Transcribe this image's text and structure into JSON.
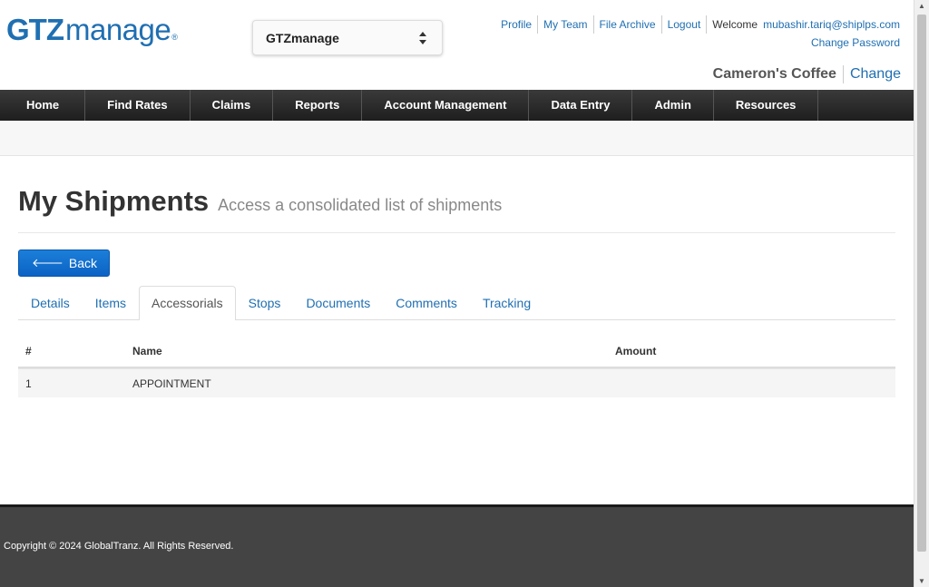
{
  "header": {
    "logo_bold": "GTZ",
    "logo_light": "manage",
    "logo_reg": "®",
    "app_select_value": "GTZmanage",
    "links": [
      "Profile",
      "My Team",
      "File Archive",
      "Logout"
    ],
    "welcome": "Welcome",
    "email": "mubashir.tariq@shiplps.com",
    "change_password": "Change Password",
    "company": "Cameron's Coffee",
    "company_change": "Change"
  },
  "nav": [
    "Home",
    "Find Rates",
    "Claims",
    "Reports",
    "Account Management",
    "Data Entry",
    "Admin",
    "Resources"
  ],
  "page": {
    "title": "My Shipments",
    "subtitle": "Access a consolidated list of shipments",
    "back_label": "Back"
  },
  "tabs": [
    {
      "label": "Details",
      "active": false
    },
    {
      "label": "Items",
      "active": false
    },
    {
      "label": "Accessorials",
      "active": true
    },
    {
      "label": "Stops",
      "active": false
    },
    {
      "label": "Documents",
      "active": false
    },
    {
      "label": "Comments",
      "active": false
    },
    {
      "label": "Tracking",
      "active": false
    }
  ],
  "table": {
    "headers": [
      "#",
      "Name",
      "Amount"
    ],
    "rows": [
      [
        "1",
        "APPOINTMENT",
        ""
      ]
    ]
  },
  "footer": {
    "copyright": "Copyright © 2024 GlobalTranz. All Rights Reserved."
  },
  "colors": {
    "brand_blue": "#1f6fb2",
    "nav_bg": "#2b2b2b",
    "button_blue": "#0b63c4",
    "footer_bg": "#444444"
  }
}
